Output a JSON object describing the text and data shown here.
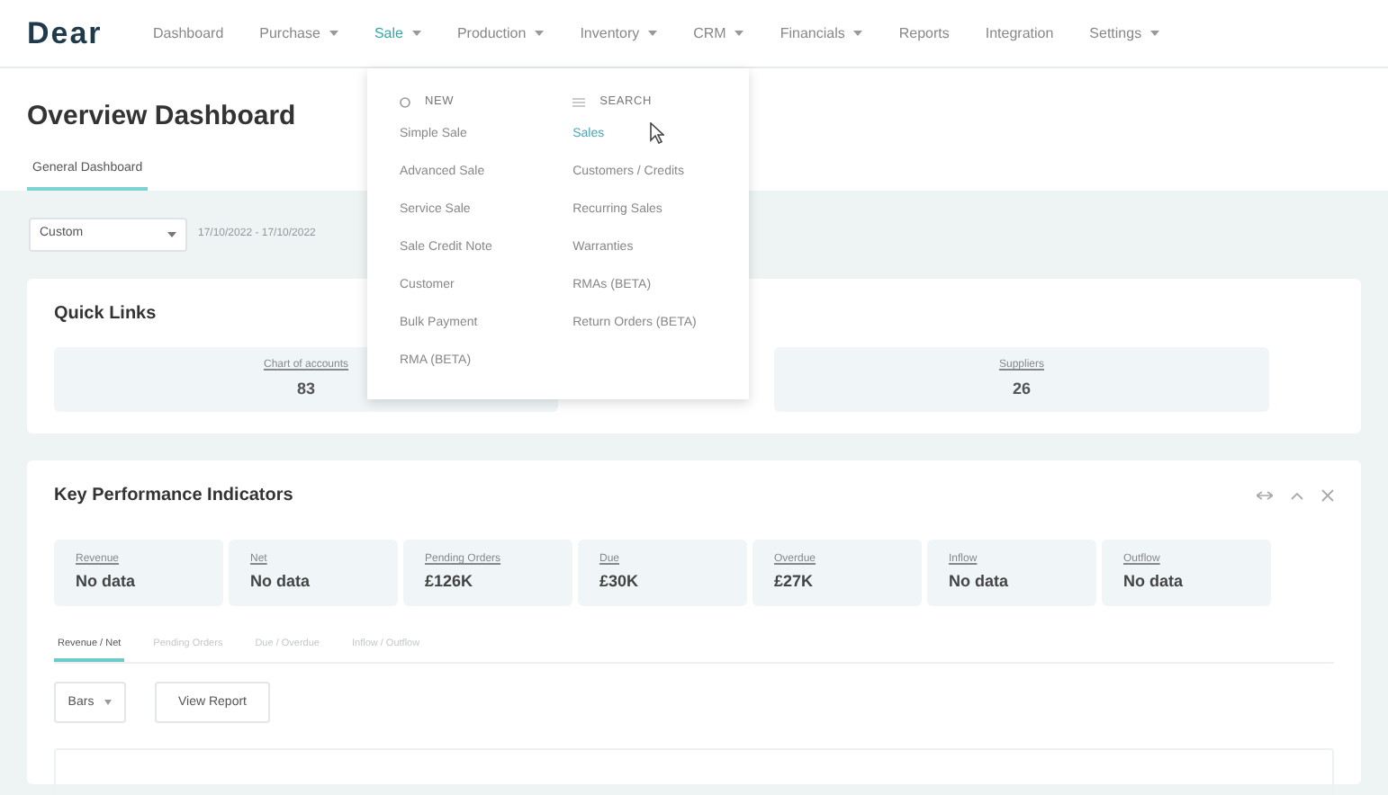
{
  "logo": "Dear",
  "nav": [
    {
      "label": "Dashboard",
      "has_menu": false,
      "selected": false
    },
    {
      "label": "Purchase",
      "has_menu": true,
      "selected": false
    },
    {
      "label": "Sale",
      "has_menu": true,
      "selected": true
    },
    {
      "label": "Production",
      "has_menu": true,
      "selected": false
    },
    {
      "label": "Inventory",
      "has_menu": true,
      "selected": false
    },
    {
      "label": "CRM",
      "has_menu": true,
      "selected": false
    },
    {
      "label": "Financials",
      "has_menu": true,
      "selected": false
    },
    {
      "label": "Reports",
      "has_menu": false,
      "selected": false
    },
    {
      "label": "Integration",
      "has_menu": false,
      "selected": false
    },
    {
      "label": "Settings",
      "has_menu": true,
      "selected": false
    }
  ],
  "menu": {
    "columns": [
      {
        "heading": "NEW",
        "kind": "new",
        "items": [
          {
            "label": "Simple Sale",
            "selected": false
          },
          {
            "label": "Advanced Sale",
            "selected": false
          },
          {
            "label": "Service Sale",
            "selected": false
          },
          {
            "label": "Sale Credit Note",
            "selected": false
          },
          {
            "label": "Customer",
            "selected": false
          },
          {
            "label": "Bulk Payment",
            "selected": false
          },
          {
            "label": "RMA (BETA)",
            "selected": false
          }
        ]
      },
      {
        "heading": "SEARCH",
        "kind": "search",
        "items": [
          {
            "label": "Sales",
            "selected": true
          },
          {
            "label": "Customers / Credits",
            "selected": false
          },
          {
            "label": "Recurring Sales",
            "selected": false
          },
          {
            "label": "Warranties",
            "selected": false
          },
          {
            "label": "RMAs (BETA)",
            "selected": false
          },
          {
            "label": "Return Orders (BETA)",
            "selected": false
          }
        ]
      }
    ]
  },
  "page_title": "Overview Dashboard",
  "page_tabs": [
    {
      "label": "General Dashboard",
      "selected": true
    }
  ],
  "period": {
    "value": "Custom",
    "range": "17/10/2022 - 17/10/2022"
  },
  "quick_links": {
    "title": "Quick Links",
    "items": [
      {
        "label": "Chart of accounts",
        "value": "83"
      },
      {
        "label": "Suppliers",
        "value": "26"
      }
    ]
  },
  "kpi": {
    "title": "Key Performance Indicators",
    "tiles": [
      {
        "label": "Revenue",
        "value": "No data"
      },
      {
        "label": "Net",
        "value": "No data"
      },
      {
        "label": "Pending Orders",
        "value": "£126K"
      },
      {
        "label": "Due",
        "value": "£30K"
      },
      {
        "label": "Overdue",
        "value": "£27K"
      },
      {
        "label": "Inflow",
        "value": "No data"
      },
      {
        "label": "Outflow",
        "value": "No data"
      }
    ],
    "tabs": [
      {
        "label": "Revenue / Net",
        "selected": true
      },
      {
        "label": "Pending Orders",
        "selected": false
      },
      {
        "label": "Due / Overdue",
        "selected": false
      },
      {
        "label": "Inflow / Outflow",
        "selected": false
      }
    ],
    "chart_type": "Bars",
    "report_button": "View Report"
  }
}
